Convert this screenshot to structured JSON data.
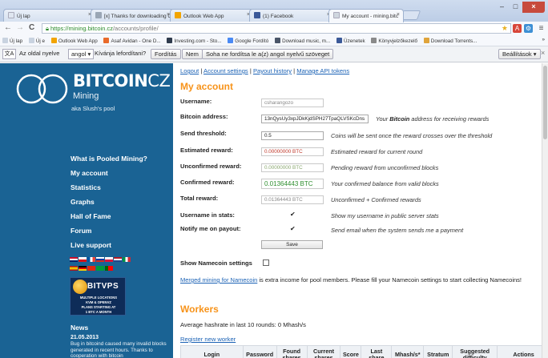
{
  "browser": {
    "tabs": [
      {
        "title": "Új lap",
        "fav": "#dfe6f0"
      },
      {
        "title": "[x] Thanks for downloading C",
        "fav": "#9aa6b5"
      },
      {
        "title": "Outlook Web App",
        "fav": "#f2a400"
      },
      {
        "title": "(1) Facebook",
        "fav": "#3b5998"
      },
      {
        "title": "My account - mining.bitc",
        "fav": "#cfd6df"
      }
    ],
    "url": {
      "host": "https://mining.bitcoin.cz",
      "path": "/accounts/profile/"
    },
    "bookmarks": [
      {
        "label": "Új lap",
        "color": "#c9d3e0"
      },
      {
        "label": "Új e",
        "color": "#c9d3e0"
      },
      {
        "label": "Outlook Web App",
        "color": "#f2a400"
      },
      {
        "label": "Asaf Avidan - One D...",
        "color": "#e96a2a"
      },
      {
        "label": "Investing.com - Sto...",
        "color": "#2f3b4d"
      },
      {
        "label": "Google Fordító",
        "color": "#4a8af4"
      },
      {
        "label": "Download music, m...",
        "color": "#4a5568"
      },
      {
        "label": "Üzenetek",
        "color": "#3b5998"
      },
      {
        "label": "Könyvjelzőkezelő",
        "color": "#8a8a8a"
      },
      {
        "label": "Download Torrents...",
        "color": "#e0a43a"
      }
    ],
    "more_bookmarks": "»",
    "translate": {
      "prefix": "Az oldal nyelve",
      "language": "angol",
      "question": "Kívánja lefordítani?",
      "translate_btn": "Fordítás",
      "no_btn": "Nem",
      "never_btn": "Soha ne fordítsa le a(z) angol nyelvű szöveget",
      "options_btn": "Beállítások",
      "close": "×"
    }
  },
  "sidebar": {
    "logo_title": "BITCOIN",
    "logo_title_cz": "CZ",
    "logo_sub": "Mining",
    "tagline": "aka Slush's pool",
    "nav": [
      "What is Pooled Mining?",
      "My account",
      "Statistics",
      "Graphs",
      "Hall of Fame",
      "Forum",
      "Live support"
    ],
    "ad": {
      "title": "BITVPS",
      "lines": [
        "MULTIPLE LOCATIONS",
        "KVM & OPENVZ",
        "PLANS STARTING AT",
        "1 BTC A MONTH"
      ]
    },
    "news_heading": "News",
    "news_date": "21.05.2013",
    "news_text": "Bug in bitcoind caused many invalid blocks generated in recent hours. Thanks to cooperation with bitcoin"
  },
  "account": {
    "links": [
      "Logout",
      "Account settings",
      "Payout history",
      "Manage API tokens"
    ],
    "heading": "My account",
    "fields": [
      {
        "label": "Username:",
        "value": "csharangozo",
        "desc": ""
      },
      {
        "label": "Bitcoin address:",
        "value": "13nQysUy3xpJDkKjdSPH27TpaQLVSKcDns",
        "desc_pre": "Your ",
        "desc_b": "Bitcoin",
        "desc_post": " address for receiving rewards"
      },
      {
        "label": "Send threshold:",
        "value": "0.5",
        "desc": "Coins will be sent once the reward crosses over the threshold"
      },
      {
        "label": "Estimated reward:",
        "value": "0.00000000 BTC",
        "desc": "Estimated reward for current round"
      },
      {
        "label": "Unconfirmed reward:",
        "value": "0.00000000 BTC",
        "desc": "Pending reward from unconfirmed blocks"
      },
      {
        "label": "Confirmed reward:",
        "value": "0.01364443 BTC",
        "desc": "Your confirmed balance from valid blocks"
      },
      {
        "label": "Total reward:",
        "value": "0.01364443 BTC",
        "desc": "Unconfirmed + Confirmed rewards"
      },
      {
        "label": "Username in stats:",
        "value": "",
        "desc": "Show my username in public server stats"
      },
      {
        "label": "Notify me on payout:",
        "value": "",
        "desc": "Send email when the system sends me a payment"
      }
    ],
    "checkmark": "✔",
    "save": "Save",
    "namecoin_label": "Show Namecoin settings",
    "namecoin_link": "Merged mining for Namecoin",
    "namecoin_text": " is extra income for pool members. Please fill your Namecoin settings to start collecting Namecoins!"
  },
  "workers": {
    "heading": "Workers",
    "hashrate": "Average hashrate in last 10 rounds: 0 Mhash/s",
    "register": "Register new worker",
    "columns": [
      "Login",
      "Password",
      "Found shares",
      "Current shares",
      "Score",
      "Last share",
      "Mhash/s*",
      "Stratum",
      "Suggested difficulty",
      "Actions"
    ]
  }
}
